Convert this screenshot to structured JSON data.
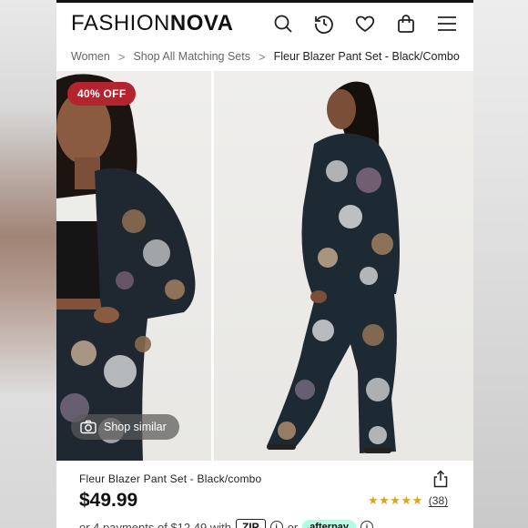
{
  "brand": {
    "logo_thin": "FASHION",
    "logo_bold": "NOVA"
  },
  "header": {
    "icons": [
      "search-icon",
      "history-icon",
      "heart-icon",
      "bag-icon",
      "menu-icon"
    ]
  },
  "breadcrumb": {
    "items": [
      "Women",
      "Shop All Matching Sets",
      "Fleur Blazer Pant Set - Black/Combo"
    ],
    "separator": ">"
  },
  "gallery": {
    "badge": "40% OFF",
    "shop_similar": "Shop similar"
  },
  "product": {
    "name": "Fleur Blazer Pant Set - Black/combo",
    "price": "$49.99",
    "stars": "★★★★★",
    "reviews": "(38)",
    "installments_text": "or 4 payments of $12.49 with",
    "zip_label": "ZIP",
    "or_text": "or",
    "afterpay_label": "afterpay"
  },
  "colors": {
    "badge": "#b3242f",
    "text": "#111111",
    "star": "#d9a520",
    "afterpay": "#b2fce4"
  }
}
